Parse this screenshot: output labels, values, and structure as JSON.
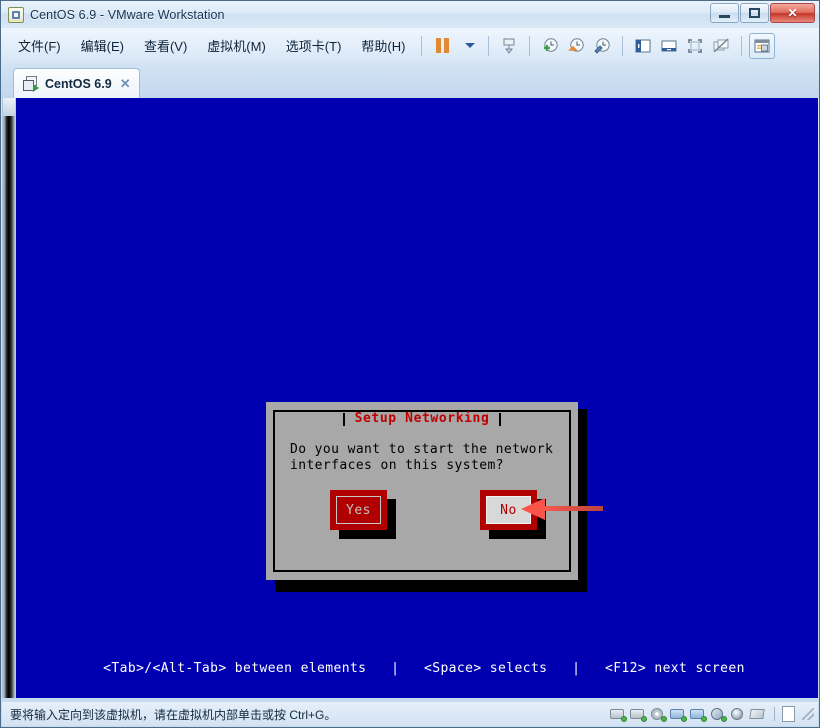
{
  "window": {
    "title": "CentOS 6.9 - VMware Workstation",
    "icon": "vmware-app-icon",
    "buttons": {
      "minimize": "minimize",
      "maximize": "maximize",
      "close": "✕"
    }
  },
  "menubar": {
    "items": [
      {
        "label": "文件(F)",
        "name": "menu-file"
      },
      {
        "label": "编辑(E)",
        "name": "menu-edit"
      },
      {
        "label": "查看(V)",
        "name": "menu-view"
      },
      {
        "label": "虚拟机(M)",
        "name": "menu-vm"
      },
      {
        "label": "选项卡(T)",
        "name": "menu-tabs"
      },
      {
        "label": "帮助(H)",
        "name": "menu-help"
      }
    ],
    "toolbar": [
      {
        "name": "suspend-button",
        "icon": "pause-icon"
      },
      {
        "name": "power-dropdown",
        "icon": "chevron-down-icon"
      },
      {
        "name": "snapshot-manager-button",
        "icon": "snapshot-icon"
      },
      {
        "name": "take-snapshot-button",
        "icon": "clock-plus-icon"
      },
      {
        "name": "revert-snapshot-button",
        "icon": "clock-back-icon"
      },
      {
        "name": "manage-snapshots-button",
        "icon": "clock-wrench-icon"
      },
      {
        "name": "show-library-button",
        "icon": "sidebar-panel-icon"
      },
      {
        "name": "show-thumbnail-bar-button",
        "icon": "thumbnail-bar-icon"
      },
      {
        "name": "enter-fullscreen-button",
        "icon": "fullscreen-icon"
      },
      {
        "name": "unity-mode-button",
        "icon": "unity-icon"
      },
      {
        "name": "console-view-button",
        "icon": "console-view-icon"
      }
    ]
  },
  "tab": {
    "label": "CentOS 6.9",
    "close": "✕",
    "icon": "vm-running-icon"
  },
  "console": {
    "dialog": {
      "title": "Setup Networking",
      "message": "Do you want to start the network\ninterfaces on this system?",
      "buttons": [
        {
          "label": "Yes",
          "name": "dialog-yes-button",
          "selected": false
        },
        {
          "label": "No",
          "name": "dialog-no-button",
          "selected": true
        }
      ]
    },
    "annotation": {
      "icon": "left-arrow-annotation",
      "color": "#fb544a"
    },
    "help": "<Tab>/<Alt-Tab> between elements   |   <Space> selects   |   <F12> next screen",
    "colors": {
      "background": "#0000b0",
      "dialog_face": "#a8a8a8",
      "button_face": "#b00000",
      "title_text": "#c00000"
    }
  },
  "statusbar": {
    "message": "要将输入定向到该虚拟机，请在虚拟机内部单击或按 Ctrl+G。",
    "devices": [
      {
        "name": "status-device-harddisk-1",
        "icon": "harddisk-icon"
      },
      {
        "name": "status-device-harddisk-2",
        "icon": "harddisk-icon"
      },
      {
        "name": "status-device-cdrom",
        "icon": "cd-icon"
      },
      {
        "name": "status-device-network-1",
        "icon": "network-icon"
      },
      {
        "name": "status-device-network-2",
        "icon": "network-icon"
      },
      {
        "name": "status-device-sound",
        "icon": "sound-icon"
      },
      {
        "name": "status-device-camera",
        "icon": "webcam-icon"
      },
      {
        "name": "status-device-printer",
        "icon": "printer-icon"
      }
    ]
  }
}
